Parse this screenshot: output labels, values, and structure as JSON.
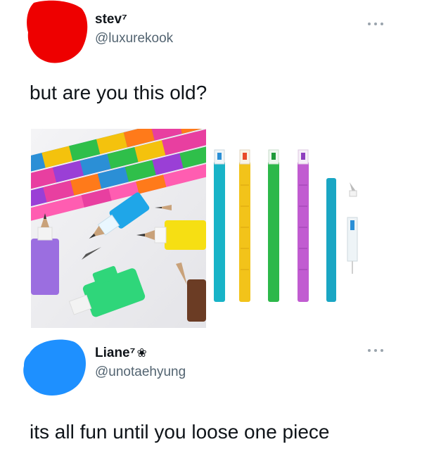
{
  "tweet": {
    "display_name": "stev⁷",
    "handle": "@luxurekook",
    "text": "but are you this old?",
    "avatar_color": "#ee0000",
    "more_icon": "more-horizontal-icon"
  },
  "reply": {
    "display_name": "Liane⁷",
    "name_emoji": "❀",
    "handle": "@unotaehyung",
    "text": "its all fun until you loose one piece",
    "avatar_color": "#1e90ff",
    "more_icon": "more-horizontal-icon"
  },
  "media": {
    "left_image": "stackable-pencils-photo",
    "right_image": "stackable-pencils-product-photo"
  }
}
